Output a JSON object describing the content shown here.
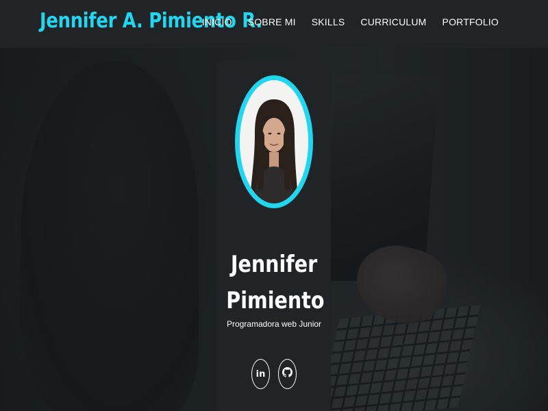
{
  "header": {
    "brand": "Jennifer A. Pimiento R.",
    "nav": [
      {
        "label": "INICIO"
      },
      {
        "label": "SOBRE MI"
      },
      {
        "label": "SKILLS"
      },
      {
        "label": "CURRICULUM"
      },
      {
        "label": "PORTFOLIO"
      }
    ]
  },
  "profile": {
    "name_line1": "Jennifer",
    "name_line2": "Pimiento",
    "role": "Programadora web Junior",
    "socials": [
      {
        "icon": "linkedin-icon",
        "text": "in"
      },
      {
        "icon": "github-icon"
      }
    ]
  },
  "colors": {
    "accent": "#20d7f2",
    "navbar": "#212426",
    "card": "#212426",
    "text": "#ffffff"
  }
}
